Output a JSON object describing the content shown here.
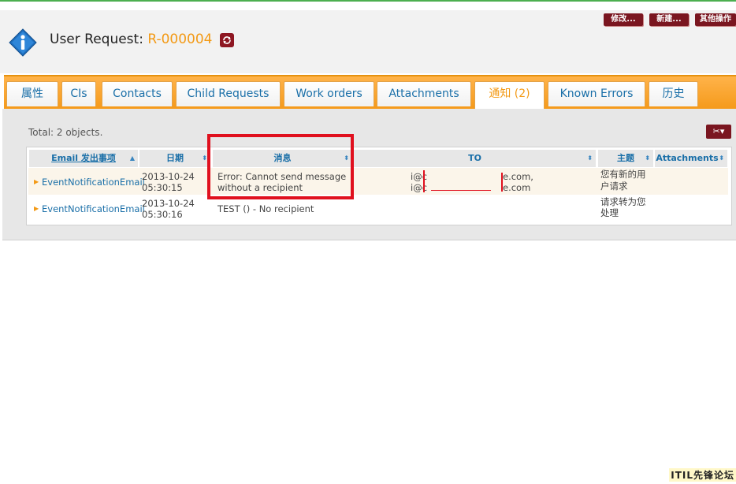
{
  "header": {
    "title_prefix": "User Request:",
    "ref": "R-000004",
    "actions": [
      "修改...",
      "新建...",
      "其他操作"
    ]
  },
  "tabs": [
    {
      "label": "属性",
      "active": false
    },
    {
      "label": "CIs",
      "active": false
    },
    {
      "label": "Contacts",
      "active": false
    },
    {
      "label": "Child Requests",
      "active": false
    },
    {
      "label": "Work orders",
      "active": false
    },
    {
      "label": "Attachments",
      "active": false
    },
    {
      "label": "通知 (2)",
      "active": true
    },
    {
      "label": "Known Errors",
      "active": false
    },
    {
      "label": "历史",
      "active": false
    }
  ],
  "list": {
    "total": "Total: 2 objects.",
    "columns": [
      "Email 发出事项",
      "日期",
      "消息",
      "TO",
      "主题",
      "Attachments"
    ],
    "rows": [
      {
        "type": "EventNotificationEmail",
        "date_line1": "2013-10-24",
        "date_line2": "05:30:15",
        "message_line1": "Error: Cannot send message",
        "message_line2": "without a recipient",
        "to_part1_line1": "i@c",
        "to_part1_line2": "i@c",
        "to_part2_line1": "e.com,",
        "to_part2_line2": "e.com",
        "subject_line1": "您有新的用",
        "subject_line2": "户请求"
      },
      {
        "type": "EventNotificationEmail",
        "date_line1": "2013-10-24",
        "date_line2": "05:30:16",
        "message_line1": "TEST () - No recipient",
        "subject_line1": "请求转为您",
        "subject_line2": "处理"
      }
    ]
  },
  "watermark": "ITIL先锋论坛",
  "colors": {
    "accent_orange": "#f39a16",
    "link_blue": "#1a6fa8",
    "button_maroon": "#7a1620",
    "highlight_red": "#e0101e"
  }
}
